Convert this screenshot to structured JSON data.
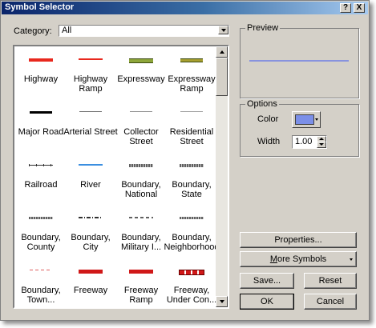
{
  "window": {
    "title": "Symbol Selector",
    "help_button": "?",
    "close_button": "X"
  },
  "category": {
    "label": "Category:",
    "value": "All"
  },
  "symbols": [
    {
      "name": "Highway",
      "color": "#e8281e"
    },
    {
      "name": "Highway Ramp",
      "color": "#e8281e"
    },
    {
      "name": "Expressway",
      "color": "#8ea63a"
    },
    {
      "name": "Expressway Ramp",
      "color": "#a8a030"
    },
    {
      "name": "Major Road",
      "color": "#000000"
    },
    {
      "name": "Arterial Street",
      "color": "#707070"
    },
    {
      "name": "Collector Street",
      "color": "#909090"
    },
    {
      "name": "Residential Street",
      "color": "#a0a0a0"
    },
    {
      "name": "Railroad",
      "color": "#303030"
    },
    {
      "name": "River",
      "color": "#3b8fe0"
    },
    {
      "name": "Boundary, National",
      "color": "#606060"
    },
    {
      "name": "Boundary, State",
      "color": "#606060"
    },
    {
      "name": "Boundary, County",
      "color": "#606060"
    },
    {
      "name": "Boundary, City",
      "color": "#303030"
    },
    {
      "name": "Boundary, Military I...",
      "color": "#606060"
    },
    {
      "name": "Boundary, Neighborhood",
      "color": "#606060"
    },
    {
      "name": "Boundary, Town...",
      "color": "#e06060"
    },
    {
      "name": "Freeway",
      "color": "#d01818"
    },
    {
      "name": "Freeway Ramp",
      "color": "#d01818"
    },
    {
      "name": "Freeway, Under Con...",
      "color": "#d01818"
    }
  ],
  "preview": {
    "label": "Preview",
    "line_color": "#6f7fe6"
  },
  "options": {
    "label": "Options",
    "color_label": "Color",
    "color_value": "#7b8fe8",
    "width_label": "Width",
    "width_value": "1.00"
  },
  "buttons": {
    "properties": "Properties...",
    "more_symbols": "More Symbols",
    "save": "Save...",
    "reset": "Reset",
    "ok": "OK",
    "cancel": "Cancel"
  }
}
